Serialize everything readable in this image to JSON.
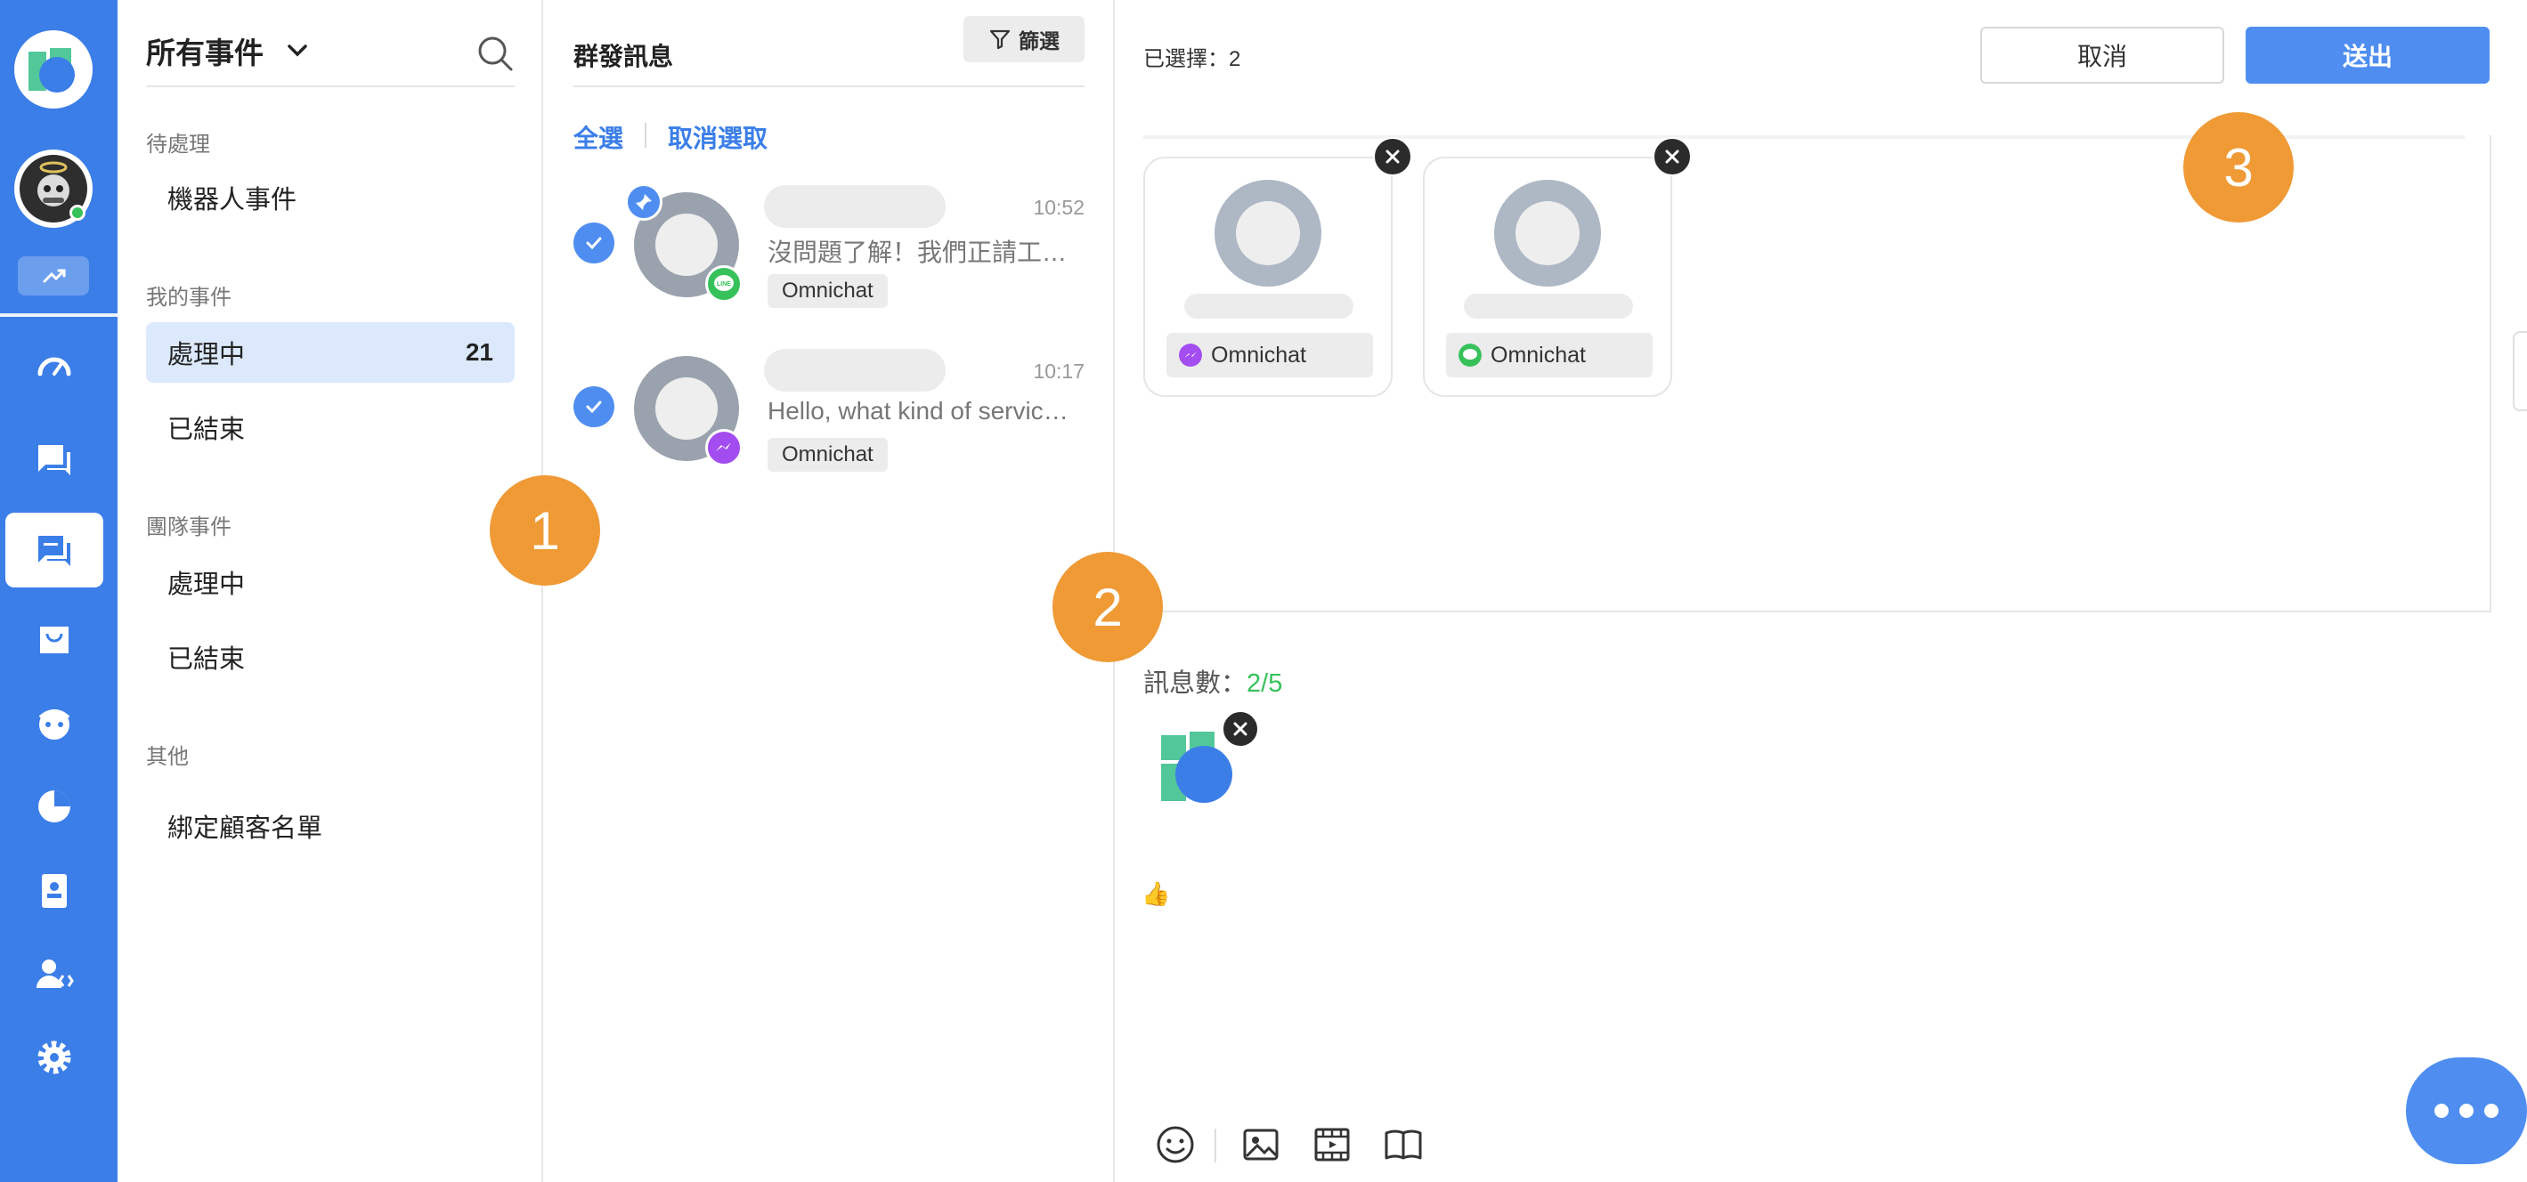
{
  "sidebar": {
    "title": "所有事件",
    "sections": [
      {
        "label": "待處理",
        "items": [
          {
            "label": "機器人事件"
          }
        ]
      },
      {
        "label": "我的事件",
        "items": [
          {
            "label": "處理中",
            "count": "21"
          },
          {
            "label": "已結束"
          }
        ]
      },
      {
        "label": "團隊事件",
        "items": [
          {
            "label": "處理中"
          },
          {
            "label": "已結束"
          }
        ]
      },
      {
        "label": "其他",
        "items": [
          {
            "label": "綁定顧客名單"
          }
        ]
      }
    ]
  },
  "list": {
    "title": "群發訊息",
    "filter_label": "篩選",
    "select_all": "全選",
    "deselect": "取消選取",
    "conversations": [
      {
        "time": "10:52",
        "preview": "沒問題了解！我們正請工作人員確認中",
        "tag": "Omnichat",
        "channel": "line",
        "pinned": true,
        "selected": true
      },
      {
        "time": "10:17",
        "preview": "Hello, what kind of service are you looking for?",
        "tag": "Omnichat",
        "channel": "messenger",
        "pinned": false,
        "selected": true
      }
    ]
  },
  "compose": {
    "selected_label": "已選擇：2",
    "cancel_label": "取消",
    "send_label": "送出",
    "recipients": [
      {
        "tag": "Omnichat",
        "channel": "messenger"
      },
      {
        "tag": "Omnichat",
        "channel": "line"
      }
    ],
    "message_count_label": "訊息數：",
    "message_count_value": "2/5",
    "emoji_text": "👍"
  },
  "badges": [
    "1",
    "2",
    "3"
  ],
  "icons": {
    "rail": [
      "dashboard-icon",
      "chat-icon",
      "broadcast-icon",
      "shop-icon",
      "bot-icon",
      "report-icon",
      "contact-icon",
      "team-icon",
      "settings-icon"
    ],
    "toolbar": [
      "emoji-icon",
      "image-icon",
      "video-icon",
      "library-icon"
    ]
  },
  "colors": {
    "brand": "#3b7ee8",
    "accent": "#4f8ef0",
    "active_bg": "#dce9fd",
    "badge": "#f09a36",
    "count_ok": "#37c15a",
    "line": "#37c15a",
    "messenger": "#a34cf0"
  }
}
